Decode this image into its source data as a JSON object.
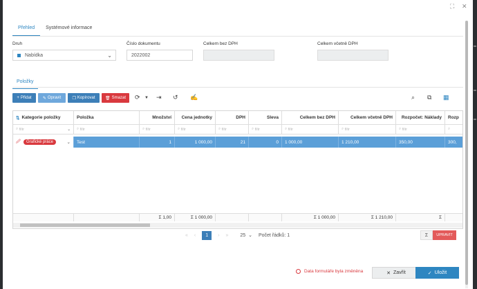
{
  "window": {
    "maximize_icon": "⛶",
    "close_icon": "✕"
  },
  "tabs": [
    {
      "label": "Přehled"
    },
    {
      "label": "Systémové informace"
    }
  ],
  "form": {
    "druh_label": "Druh",
    "druh_value": "Nabídka",
    "cislo_label": "Číslo dokumentu",
    "cislo_value": "2022002",
    "bez_dph_label": "Celkem bez DPH",
    "bez_dph_value": "",
    "vcetne_dph_label": "Celkem včetně DPH",
    "vcetne_dph_value": ""
  },
  "section_tab": "Položky",
  "toolbar": {
    "add": "Přidat",
    "edit": "Opravit",
    "copy": "Kopírovat",
    "delete": "Smazat"
  },
  "grid": {
    "headers": [
      "Kategorie položky",
      "Položka",
      "Množství",
      "Cena jednotky",
      "DPH",
      "Sleva",
      "Celkem bez DPH",
      "Celkem včetně DPH",
      "Rozpočet: Náklady",
      "Rozp"
    ],
    "filter_placeholder": "filtr",
    "row": {
      "category": "Grafické práce",
      "item": "Test",
      "qty": "1",
      "unit_price": "1 000,00",
      "vat": "21",
      "discount": "0",
      "total_ex": "1 000,00",
      "total_inc": "1 210,00",
      "budget": "350,00",
      "budget2": "300,"
    },
    "footer": {
      "qty": "Σ 1,00",
      "unit_price": "Σ 1 000,00",
      "total_ex": "Σ 1 000,00",
      "total_inc": "Σ 1 210,00",
      "budget": "Σ"
    }
  },
  "pager": {
    "first": "«",
    "prev": "‹",
    "page": "1",
    "next": "›",
    "last": "»",
    "page_size": "25",
    "row_count": "Počet řádků: 1",
    "sigma": "Σ",
    "edit": "UPRAVIT"
  },
  "footer": {
    "status": "Data formuláře byla změněna",
    "close": "Zavřít",
    "save": "Uložit"
  },
  "colors": {
    "accent": "#2e86c1",
    "danger": "#d9393e",
    "selected_row": "#5b9fd8"
  }
}
